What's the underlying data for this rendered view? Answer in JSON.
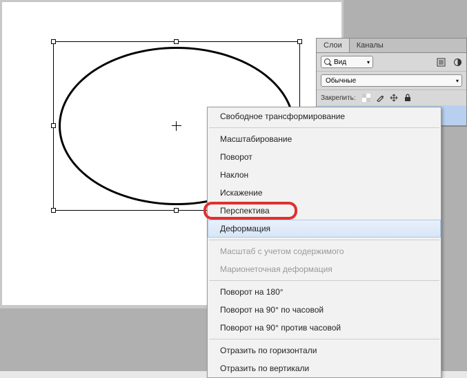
{
  "panel": {
    "tabs": {
      "layers": "Слои",
      "channels": "Каналы"
    },
    "kind": {
      "label": "Вид"
    },
    "mode": {
      "label": "Обычные"
    },
    "lock": {
      "label": "Закрепить:"
    }
  },
  "menu": {
    "free_transform": "Свободное трансформирование",
    "scale": "Масштабирование",
    "rotate": "Поворот",
    "skew": "Наклон",
    "distort": "Искажение",
    "perspective": "Перспектива",
    "warp": "Деформация",
    "content_aware": "Масштаб с учетом содержимого",
    "puppet": "Марионеточная деформация",
    "rotate180": "Поворот на 180°",
    "rotate90cw": "Поворот на 90° по часовой",
    "rotate90ccw": "Поворот на 90° против часовой",
    "flip_h": "Отразить по горизонтали",
    "flip_v": "Отразить по вертикали"
  }
}
